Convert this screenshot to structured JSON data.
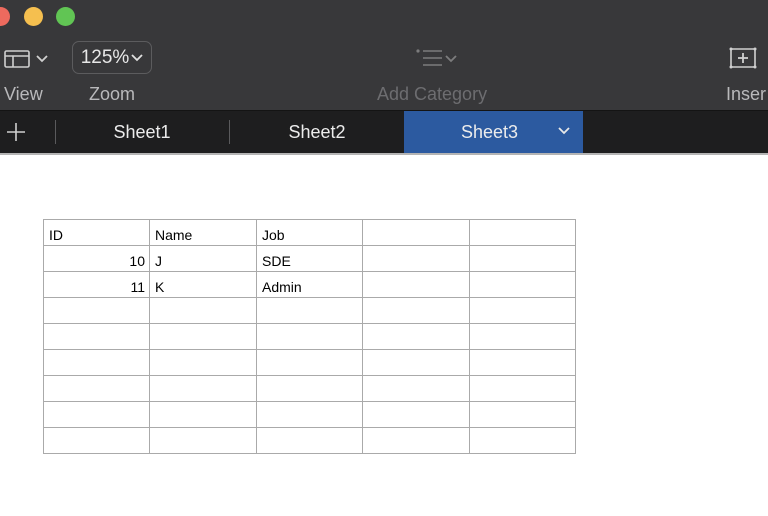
{
  "toolbar": {
    "view_label": "View",
    "zoom_value": "125%",
    "zoom_label": "Zoom",
    "add_category_label": "Add Category",
    "insert_label": "Inser"
  },
  "tabs": [
    {
      "label": "Sheet1"
    },
    {
      "label": "Sheet2"
    },
    {
      "label": "Sheet3",
      "active": true
    }
  ],
  "colors": {
    "toolbar_bg": "#38383a",
    "tabbar_bg": "#1e1e1f",
    "active_tab": "#2c5aa0"
  },
  "sheet": {
    "header": [
      "ID",
      "Name",
      "Job",
      "",
      ""
    ],
    "rows": [
      [
        "10",
        "J",
        "SDE",
        "",
        ""
      ],
      [
        "11",
        "K",
        "Admin",
        "",
        ""
      ],
      [
        "",
        "",
        "",
        "",
        ""
      ],
      [
        "",
        "",
        "",
        "",
        ""
      ],
      [
        "",
        "",
        "",
        "",
        ""
      ],
      [
        "",
        "",
        "",
        "",
        ""
      ],
      [
        "",
        "",
        "",
        "",
        ""
      ],
      [
        "",
        "",
        "",
        "",
        ""
      ]
    ]
  }
}
